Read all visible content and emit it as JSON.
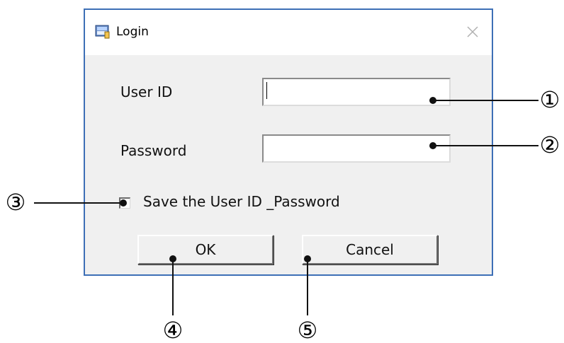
{
  "window": {
    "title": "Login",
    "icon": "login-app-icon",
    "close_icon": "close-icon"
  },
  "form": {
    "user_id_label": "User ID",
    "user_id_value": "",
    "password_label": "Password",
    "password_value": "",
    "save_checkbox_label": "Save the User ID _Password",
    "save_checked": false,
    "ok_label": "OK",
    "cancel_label": "Cancel"
  },
  "callouts": {
    "items": [
      "①",
      "②",
      "③",
      "④",
      "⑤"
    ]
  },
  "colors": {
    "window_border": "#3d6fb6",
    "dialog_body": "#f0f0f0",
    "titlebar": "#ffffff"
  }
}
